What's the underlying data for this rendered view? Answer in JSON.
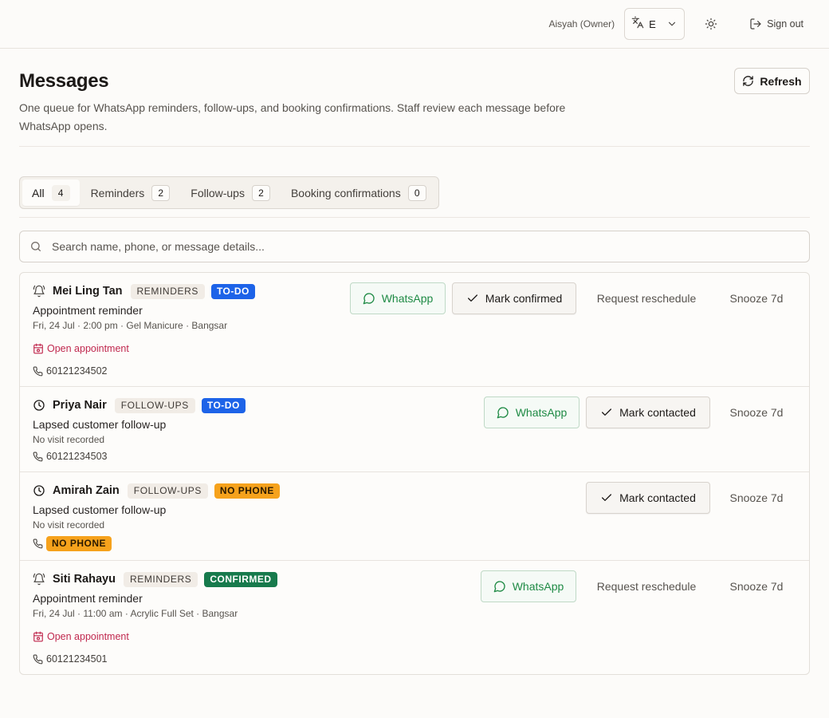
{
  "topbar": {
    "user": "Aisyah (Owner)",
    "language": "E",
    "sign_out": "Sign out",
    "icons": {
      "translate": "translate-icon",
      "chevron": "chevron-down-icon",
      "theme": "sun-icon",
      "sign_out": "sign-out-icon"
    }
  },
  "header": {
    "title": "Messages",
    "description": "One queue for WhatsApp reminders, follow-ups, and booking confirmations. Staff review each message before WhatsApp opens.",
    "refresh": "Refresh"
  },
  "tabs": [
    {
      "label": "All",
      "count": "4",
      "active": true
    },
    {
      "label": "Reminders",
      "count": "2"
    },
    {
      "label": "Follow-ups",
      "count": "2"
    },
    {
      "label": "Booking confirmations",
      "count": "0"
    }
  ],
  "search": {
    "placeholder": "Search name, phone, or message details..."
  },
  "colors": {
    "todo": "#1d63e8",
    "no_phone": "#f6a21c",
    "confirmed": "#177a4c",
    "whatsapp": "#1e8a44",
    "open_link": "#c0284e"
  },
  "messages": [
    {
      "icon": "bell-icon",
      "name": "Mei Ling Tan",
      "tag": "REMINDERS",
      "status": "TO-DO",
      "subject": "Appointment reminder",
      "detail": "Fri, 24 Jul · 2:00 pm · Gel Manicure · Bangsar",
      "open_link": "Open appointment",
      "phone": "60121234502",
      "actions": {
        "whatsapp": "WhatsApp",
        "mark": "Mark confirmed",
        "reschedule": "Request reschedule",
        "snooze": "Snooze 7d"
      }
    },
    {
      "icon": "clock-icon",
      "name": "Priya Nair",
      "tag": "FOLLOW-UPS",
      "status": "TO-DO",
      "subject": "Lapsed customer follow-up",
      "detail": "No visit recorded",
      "phone": "60121234503",
      "actions": {
        "whatsapp": "WhatsApp",
        "mark": "Mark contacted",
        "snooze": "Snooze 7d"
      }
    },
    {
      "icon": "clock-icon",
      "name": "Amirah Zain",
      "tag": "FOLLOW-UPS",
      "status": "NO PHONE",
      "subject": "Lapsed customer follow-up",
      "detail": "No visit recorded",
      "phone_badge": "NO PHONE",
      "actions": {
        "mark": "Mark contacted",
        "snooze": "Snooze 7d"
      }
    },
    {
      "icon": "bell-icon",
      "name": "Siti Rahayu",
      "tag": "REMINDERS",
      "status": "CONFIRMED",
      "subject": "Appointment reminder",
      "detail": "Fri, 24 Jul · 11:00 am · Acrylic Full Set · Bangsar",
      "open_link": "Open appointment",
      "phone": "60121234501",
      "actions": {
        "whatsapp": "WhatsApp",
        "reschedule": "Request reschedule",
        "snooze": "Snooze 7d"
      }
    }
  ]
}
